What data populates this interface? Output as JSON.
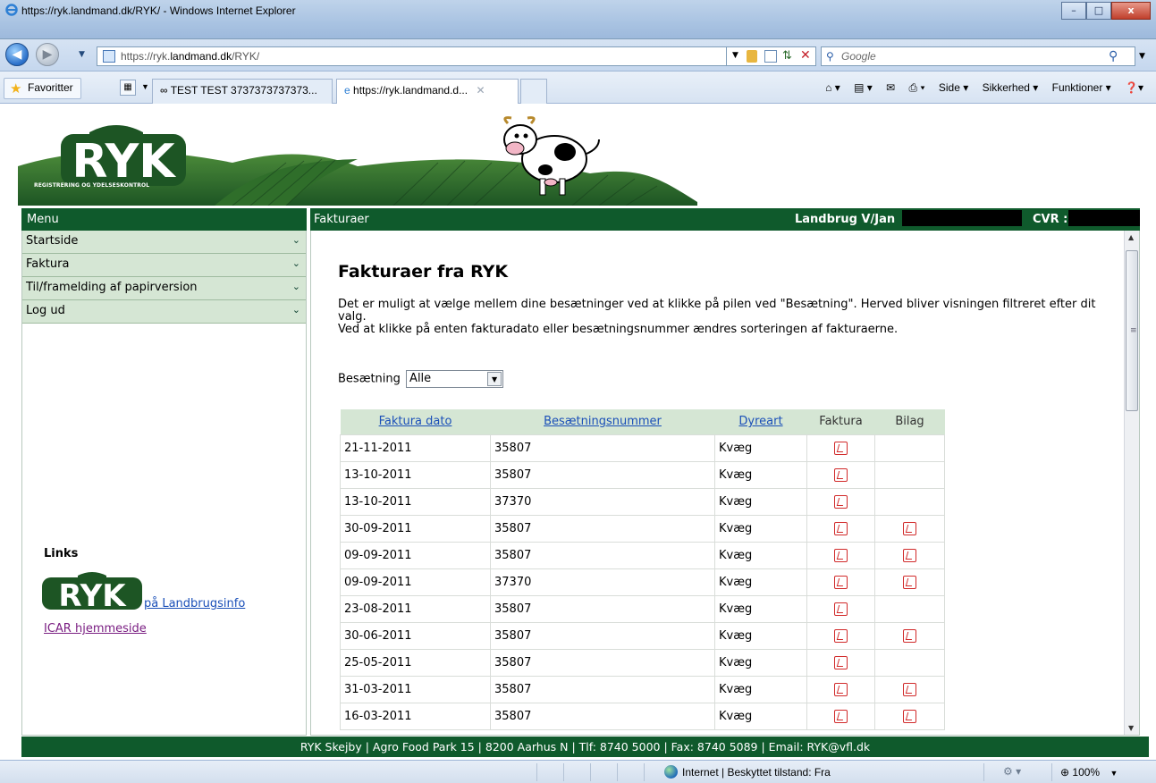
{
  "window": {
    "title": "https://ryk.landmand.dk/RYK/ - Windows Internet Explorer",
    "min": "–",
    "max": "□",
    "close": "x"
  },
  "address": {
    "url_prefix": "https://ryk.",
    "url_host": "landmand.dk",
    "url_path": "/RYK/",
    "search_placeholder": "Google"
  },
  "favorites": {
    "label": "Favoritter",
    "tabs": [
      {
        "label": "TEST TEST 3737373737373..."
      },
      {
        "label": "https://ryk.landmand.d...",
        "close": "✕"
      }
    ],
    "commands": [
      "Side ▾",
      "Sikkerhed ▾",
      "Funktioner ▾"
    ]
  },
  "banner": {
    "logo_text": "RYK",
    "logo_subtitle": "REGISTRERING OG YDELSESKONTROL"
  },
  "menu": {
    "heading": "Menu",
    "items": [
      {
        "label": "Startside"
      },
      {
        "label": "Faktura"
      },
      {
        "label": "Til/framelding af papirversion"
      },
      {
        "label": "Log ud"
      }
    ],
    "links_heading": "Links",
    "link_landbrug": " på Landbrugsinfo",
    "link_icar": "ICAR hjemmeside"
  },
  "content_header": {
    "title": "Fakturaer",
    "farm": "Landbrug V/Jan",
    "cvr_label": "CVR :"
  },
  "main": {
    "title": "Fakturaer fra RYK",
    "intro_line1": "Det er muligt at vælge mellem dine besætninger ved at klikke på pilen ved \"Besætning\". Herved bliver visningen filtreret efter dit valg.",
    "intro_line2": "Ved at klikke på enten fakturadato eller besætningsnummer ændres sorteringen af fakturaerne.",
    "filter_label": "Besætning",
    "filter_value": "Alle"
  },
  "table": {
    "headers": {
      "date": "Faktura dato",
      "herd": "Besætningsnummer",
      "species": "Dyreart",
      "invoice": "Faktura",
      "attachment": "Bilag"
    },
    "rows": [
      {
        "date": "21-11-2011",
        "herd": "35807",
        "species": "Kvæg",
        "invoice": true,
        "attachment": false
      },
      {
        "date": "13-10-2011",
        "herd": "35807",
        "species": "Kvæg",
        "invoice": true,
        "attachment": false
      },
      {
        "date": "13-10-2011",
        "herd": "37370",
        "species": "Kvæg",
        "invoice": true,
        "attachment": false
      },
      {
        "date": "30-09-2011",
        "herd": "35807",
        "species": "Kvæg",
        "invoice": true,
        "attachment": true
      },
      {
        "date": "09-09-2011",
        "herd": "35807",
        "species": "Kvæg",
        "invoice": true,
        "attachment": true
      },
      {
        "date": "09-09-2011",
        "herd": "37370",
        "species": "Kvæg",
        "invoice": true,
        "attachment": true
      },
      {
        "date": "23-08-2011",
        "herd": "35807",
        "species": "Kvæg",
        "invoice": true,
        "attachment": false
      },
      {
        "date": "30-06-2011",
        "herd": "35807",
        "species": "Kvæg",
        "invoice": true,
        "attachment": true
      },
      {
        "date": "25-05-2011",
        "herd": "35807",
        "species": "Kvæg",
        "invoice": true,
        "attachment": false
      },
      {
        "date": "31-03-2011",
        "herd": "35807",
        "species": "Kvæg",
        "invoice": true,
        "attachment": true
      },
      {
        "date": "16-03-2011",
        "herd": "35807",
        "species": "Kvæg",
        "invoice": true,
        "attachment": true
      }
    ]
  },
  "footer": {
    "text": "RYK Skejby | Agro Food Park 15 | 8200 Aarhus N | Tlf: 8740 5000 | Fax: 8740 5089 | Email: RYK@vfl.dk"
  },
  "status": {
    "zone": "Internet | Beskyttet tilstand: Fra",
    "zoom": "100%"
  },
  "colors": {
    "brand_green": "#0f5a2c",
    "menu_green": "#d5e6d4",
    "pdf_red": "#d12a2a"
  }
}
